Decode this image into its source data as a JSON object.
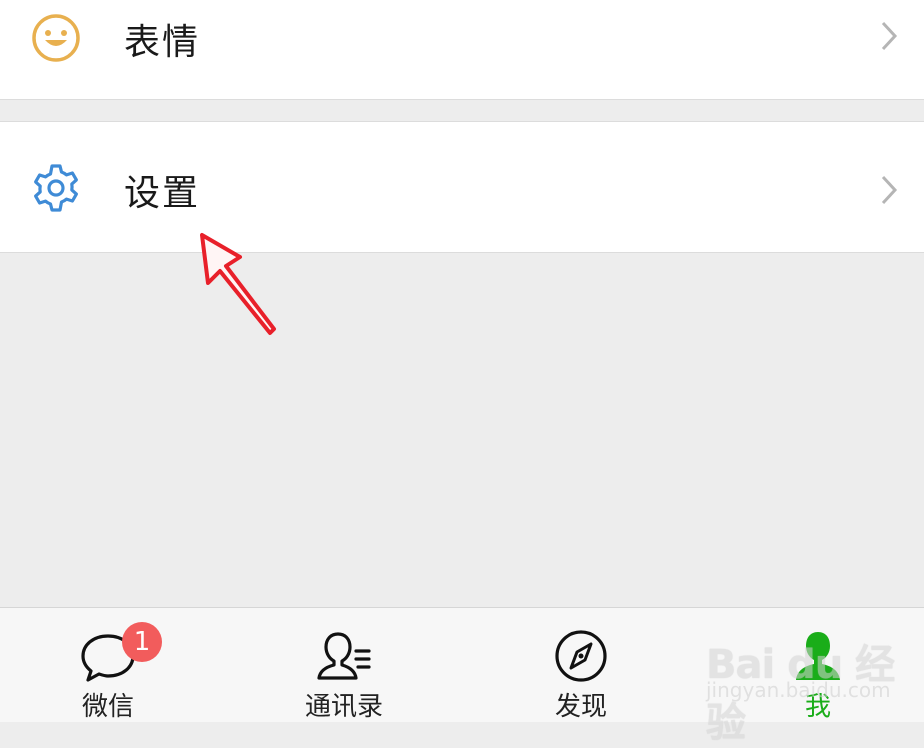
{
  "menu": {
    "emoji_label": "表情",
    "settings_label": "设置"
  },
  "tabbar": {
    "tabs": [
      {
        "label": "微信",
        "icon": "chat-bubble-icon",
        "badge": "1"
      },
      {
        "label": "通讯录",
        "icon": "contacts-icon"
      },
      {
        "label": "发现",
        "icon": "compass-icon"
      },
      {
        "label": "我",
        "icon": "person-icon",
        "active": true
      }
    ]
  },
  "watermark": {
    "brand": "Bai du 经验",
    "url": "jingyan.baidu.com"
  },
  "colors": {
    "background": "#ededed",
    "row_background": "#ffffff",
    "active_tab": "#1aad19",
    "badge": "#f25c5c",
    "emoji_icon": "#e8b04f",
    "settings_icon": "#3f8bd6",
    "annotation_arrow": "#e8202a"
  }
}
